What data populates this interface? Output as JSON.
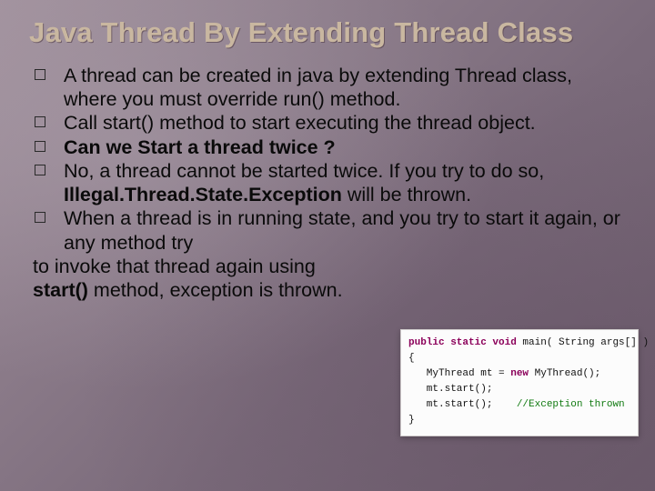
{
  "title": "Java Thread By Extending Thread Class",
  "bullets": {
    "b1": "A thread can be created in java by extending Thread class, where you must override run() method.",
    "b2": "Call start() method to start executing the thread object.",
    "b3": "Can we Start a thread twice ?",
    "b4a": "No, a thread cannot be started twice. If you try to do so, ",
    "b4b": "Illegal.Thread.State.Exception",
    "b4c": " will be thrown.",
    "b5": "When a thread is in running state, and you try to start it again, or any method try"
  },
  "trail": {
    "t1": "to invoke that thread again using",
    "t2a": " start() ",
    "t2b": "method, exception is thrown."
  },
  "code": {
    "l1a": "public static void",
    "l1b": " main( String args[] )",
    "l1c": "{",
    "l2": "   MyThread mt = ",
    "l2a": "new",
    "l2b": " MyThread();",
    "l3": "   mt.start();",
    "l4": "   mt.start();    ",
    "l4c": "//Exception thrown",
    "l5": "}"
  }
}
